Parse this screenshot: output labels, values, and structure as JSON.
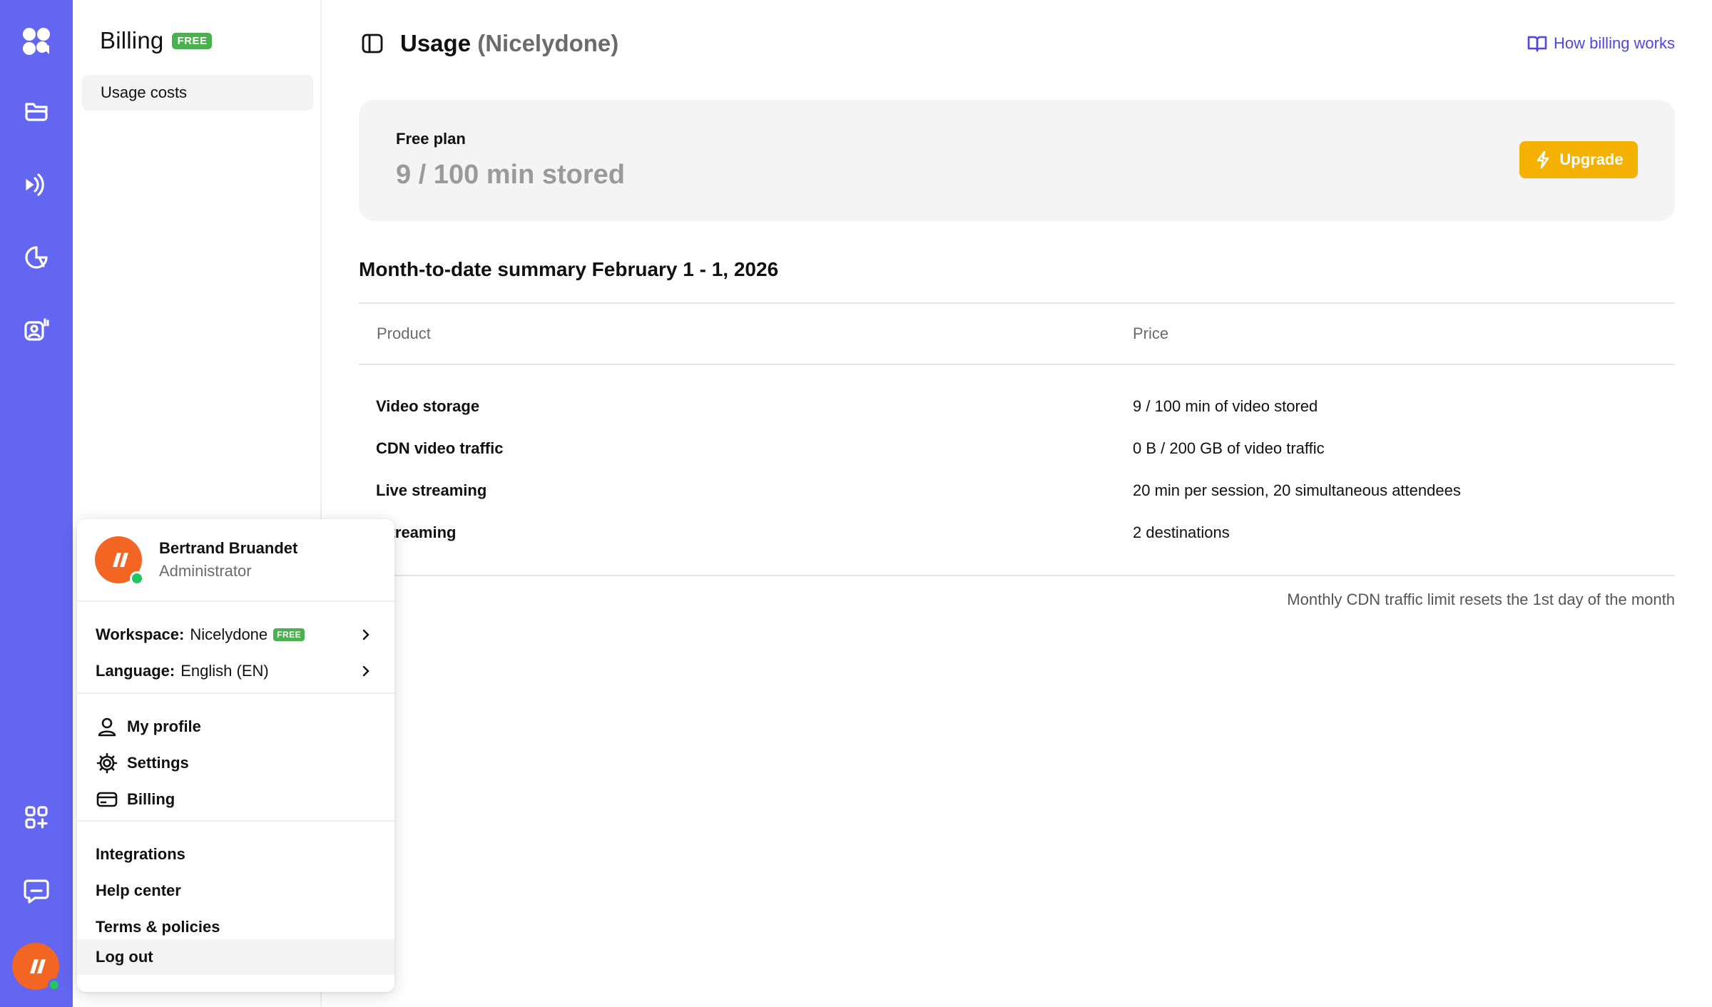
{
  "rail": {
    "items": [
      "logo-icon",
      "storage-icon",
      "live-icon",
      "analytics-icon",
      "contacts-icon",
      "apps-icon",
      "chat-icon"
    ]
  },
  "subnav": {
    "title": "Billing",
    "badge": "FREE",
    "items": [
      {
        "label": "Usage costs"
      }
    ]
  },
  "header": {
    "title": "Usage",
    "workspace": "(Nicelydone)",
    "help_link": "How billing works"
  },
  "plan": {
    "label": "Free plan",
    "value": "9 / 100 min stored",
    "upgrade_label": "Upgrade"
  },
  "summary": {
    "title": "Month-to-date summary February 1 - 1, 2026",
    "columns": [
      "Product",
      "Price"
    ],
    "rows": [
      {
        "product": "Video storage",
        "price": "9 / 100 min of video stored"
      },
      {
        "product": "CDN video traffic",
        "price": "0 B / 200 GB of video traffic"
      },
      {
        "product": "Live streaming",
        "price": "20 min per session, 20 simultaneous attendees"
      },
      {
        "product": "-streaming",
        "price": "2 destinations"
      }
    ],
    "footnote": "Monthly CDN traffic limit resets the 1st day of the month"
  },
  "user_menu": {
    "name": "Bertrand Bruandet",
    "role": "Administrator",
    "workspace_label": "Workspace:",
    "workspace_value": "Nicelydone",
    "workspace_badge": "FREE",
    "language_label": "Language:",
    "language_value": "English (EN)",
    "account_items": [
      {
        "label": "My profile",
        "icon": "user-icon"
      },
      {
        "label": "Settings",
        "icon": "gear-icon"
      },
      {
        "label": "Billing",
        "icon": "credit-card-icon"
      }
    ],
    "links": [
      "Integrations",
      "Help center",
      "Terms & policies",
      "Log out"
    ]
  },
  "colors": {
    "rail": "#6366f1",
    "accent": "#4f46e5",
    "upgrade": "#f5b100",
    "free_badge": "#4caf50",
    "avatar": "#f26522",
    "online": "#22c55e"
  }
}
